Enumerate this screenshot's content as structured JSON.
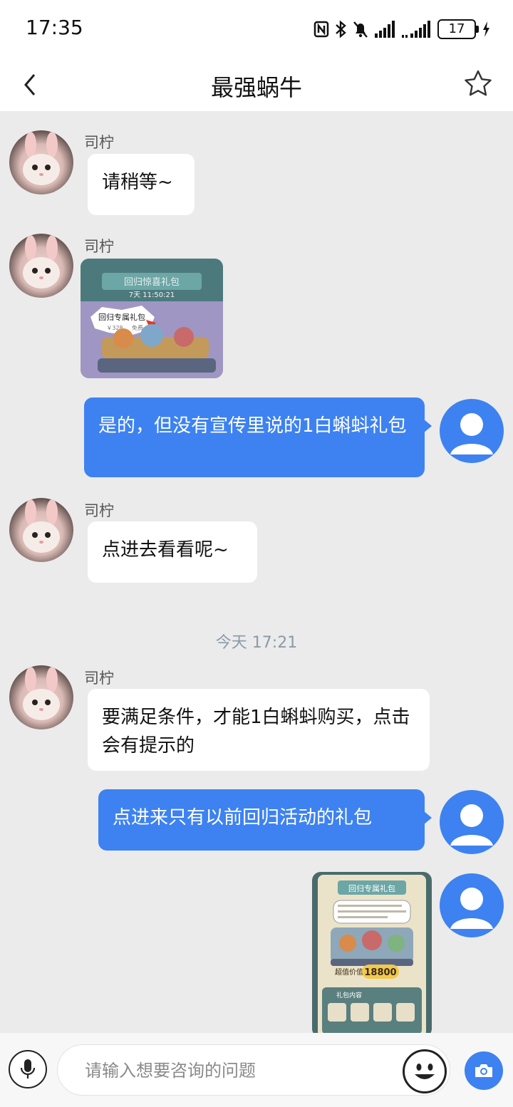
{
  "status_bar": {
    "time": "17:35",
    "battery_level": "17",
    "icons": [
      "nfc-icon",
      "bluetooth-icon",
      "mute-bell-icon",
      "signal-icon",
      "signal-icon",
      "battery-icon",
      "charging-icon"
    ]
  },
  "header": {
    "title": "最强蜗牛",
    "back_icon": "chevron-left-icon",
    "favorite_icon": "star-outline-icon"
  },
  "messages": [
    {
      "from": "agent",
      "sender": "司柠",
      "text": "请稍等~"
    },
    {
      "from": "agent",
      "sender": "司柠",
      "type": "image",
      "image": {
        "banner": "回归惊喜礼包",
        "timer": "7天 11:50:21",
        "tag": "回归专属礼包",
        "price": "￥328",
        "price_note": "免费"
      }
    },
    {
      "from": "user",
      "text": "是的，但没有宣传里说的1白蝌蚪礼包"
    },
    {
      "from": "agent",
      "sender": "司柠",
      "text": "点进去看看呢~"
    },
    {
      "type": "timestamp",
      "text": "今天 17:21"
    },
    {
      "from": "agent",
      "sender": "司柠",
      "text": "要满足条件，才能1白蝌蚪购买，点击会有提示的"
    },
    {
      "from": "user",
      "text": "点进来只有以前回归活动的礼包"
    },
    {
      "from": "user",
      "type": "image",
      "image": {
        "banner": "回归专属礼包",
        "price_label": "超值价值",
        "price_value": "18800",
        "section": "礼包内容"
      }
    }
  ],
  "input_bar": {
    "placeholder": "请输入想要咨询的问题",
    "value": ""
  },
  "colors": {
    "accent": "#3d82f0",
    "background": "#ebebeb",
    "bubble_in": "#ffffff"
  }
}
